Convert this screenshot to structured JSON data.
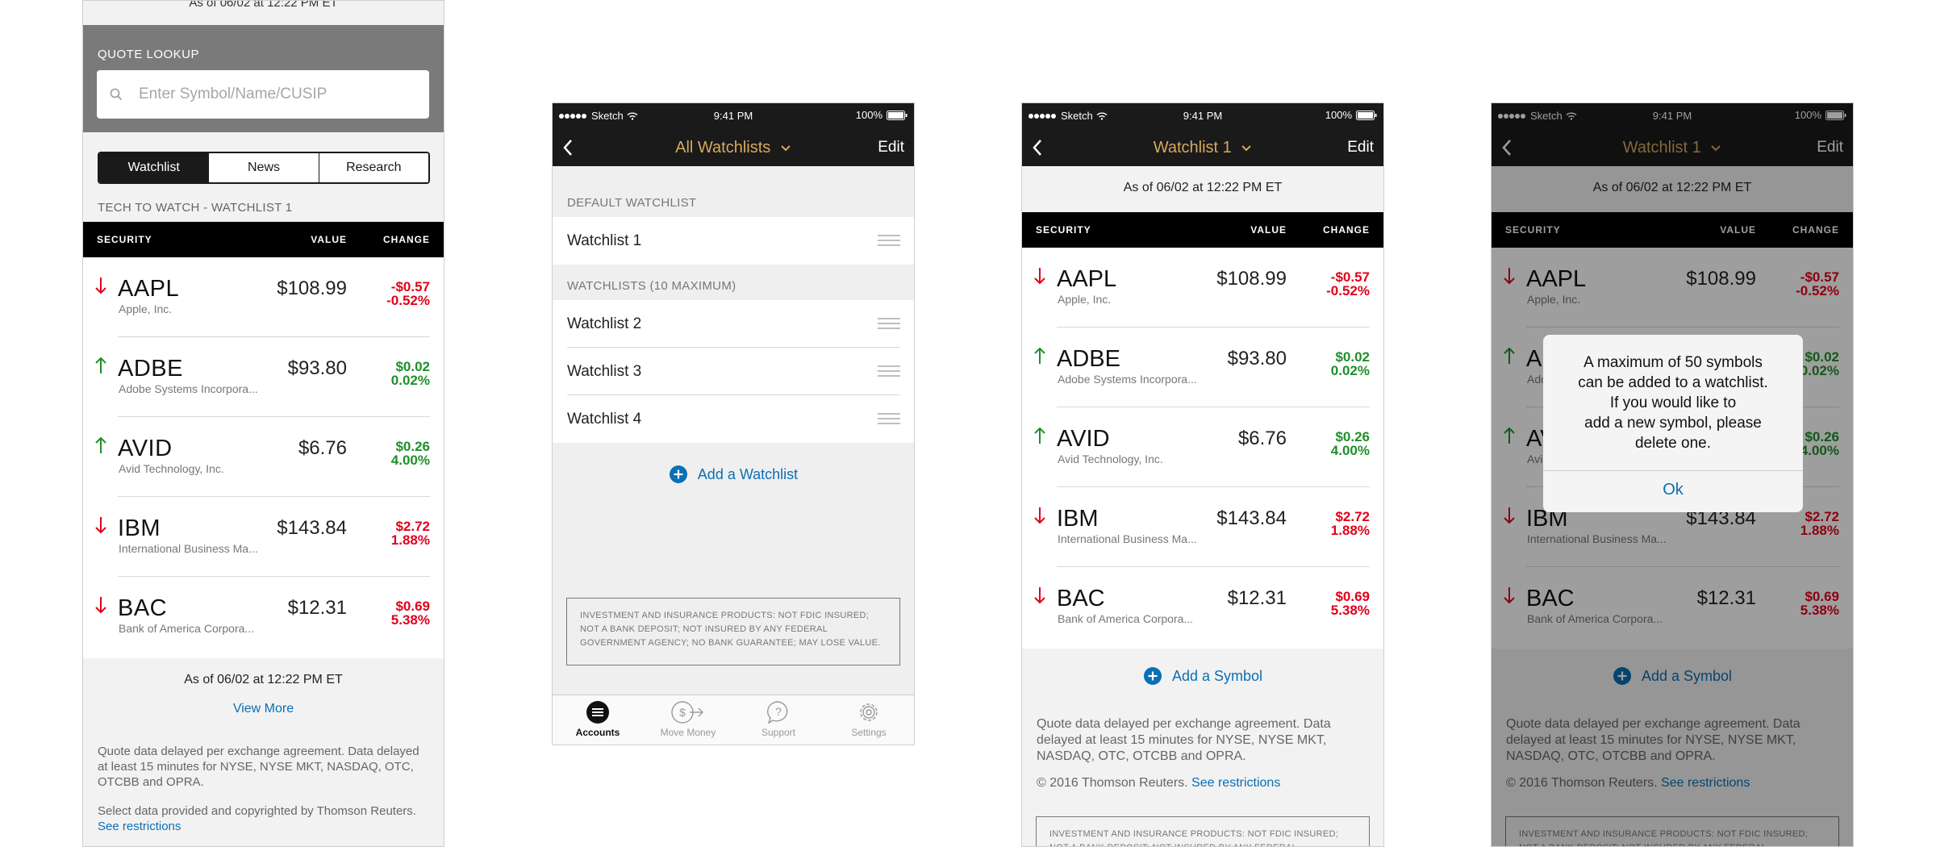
{
  "colors": {
    "up": "#1f8f2a",
    "down": "#e2001a",
    "link": "#0b6fb5",
    "nav_title": "#d6a95f"
  },
  "status_bar": {
    "carrier": "Sketch",
    "time": "9:41 PM",
    "battery": "100%"
  },
  "screen1": {
    "as_of_top": "As of 06/02 at 12:22 PM ET",
    "lookup_label": "QUOTE LOOKUP",
    "lookup_placeholder": "Enter Symbol/Name/CUSIP",
    "segments": [
      "Watchlist",
      "News",
      "Research"
    ],
    "watchlist_title": "TECH TO WATCH - WATCHLIST 1",
    "columns": {
      "security": "SECURITY",
      "value": "VALUE",
      "change": "CHANGE"
    },
    "rows": [
      {
        "direction": "down",
        "symbol": "AAPL",
        "name": "Apple, Inc.",
        "value": "$108.99",
        "change": "-$0.57",
        "pct": "-0.52%"
      },
      {
        "direction": "up",
        "symbol": "ADBE",
        "name": "Adobe Systems Incorpora...",
        "value": "$93.80",
        "change": "$0.02",
        "pct": "0.02%"
      },
      {
        "direction": "up",
        "symbol": "AVID",
        "name": "Avid Technology, Inc.",
        "value": "$6.76",
        "change": "$0.26",
        "pct": "4.00%"
      },
      {
        "direction": "down",
        "symbol": "IBM",
        "name": "International Business Ma...",
        "value": "$143.84",
        "change": "$2.72",
        "pct": "1.88%"
      },
      {
        "direction": "down",
        "symbol": "BAC",
        "name": "Bank of America Corpora...",
        "value": "$12.31",
        "change": "$0.69",
        "pct": "5.38%"
      }
    ],
    "as_of_bottom": "As of 06/02 at 12:22 PM ET",
    "view_more": "View More",
    "disclaimer": "Quote data delayed per exchange agreement. Data delayed at least 15 minutes for NYSE, NYSE MKT, NASDAQ, OTC, OTCBB and OPRA.",
    "copyright": "Select data provided and copyrighted by Thomson Reuters.",
    "see_restrictions": "See restrictions"
  },
  "screen2": {
    "nav_title": "All Watchlists",
    "edit": "Edit",
    "default_section": "DEFAULT WATCHLIST",
    "default_item": "Watchlist 1",
    "list_section": "WATCHLISTS (10 MAXIMUM)",
    "items": [
      "Watchlist 2",
      "Watchlist 3",
      "Watchlist 4"
    ],
    "add": "Add a Watchlist",
    "legal": "INVESTMENT AND INSURANCE PRODUCTS: NOT FDIC INSURED; NOT A BANK DEPOSIT; NOT INSURED BY ANY FEDERAL GOVERNMENT AGENCY; NO BANK GUARANTEE; MAY LOSE VALUE.",
    "tabs": [
      "Accounts",
      "Move Money",
      "Support",
      "Settings"
    ]
  },
  "screen3": {
    "nav_title": "Watchlist 1",
    "edit": "Edit",
    "as_of": "As of 06/02 at 12:22 PM ET",
    "add_symbol": "Add a Symbol",
    "quote_note": "Quote data delayed per exchange agreement. Data delayed at least 15 minutes for NYSE, NYSE MKT, NASDAQ, OTC, OTCBB and OPRA.",
    "copyright": "© 2016 Thomson Reuters.",
    "see_restrictions": "See restrictions",
    "legal": "INVESTMENT AND INSURANCE PRODUCTS: NOT FDIC INSURED; NOT A BANK DEPOSIT; NOT INSURED BY ANY FEDERAL GOVERNMENT"
  },
  "alert": {
    "lines": [
      "A maximum of 50 symbols",
      "can be added to a watchlist.",
      "If you would like to",
      "add a new symbol, please",
      "delete one."
    ],
    "ok": "Ok"
  }
}
